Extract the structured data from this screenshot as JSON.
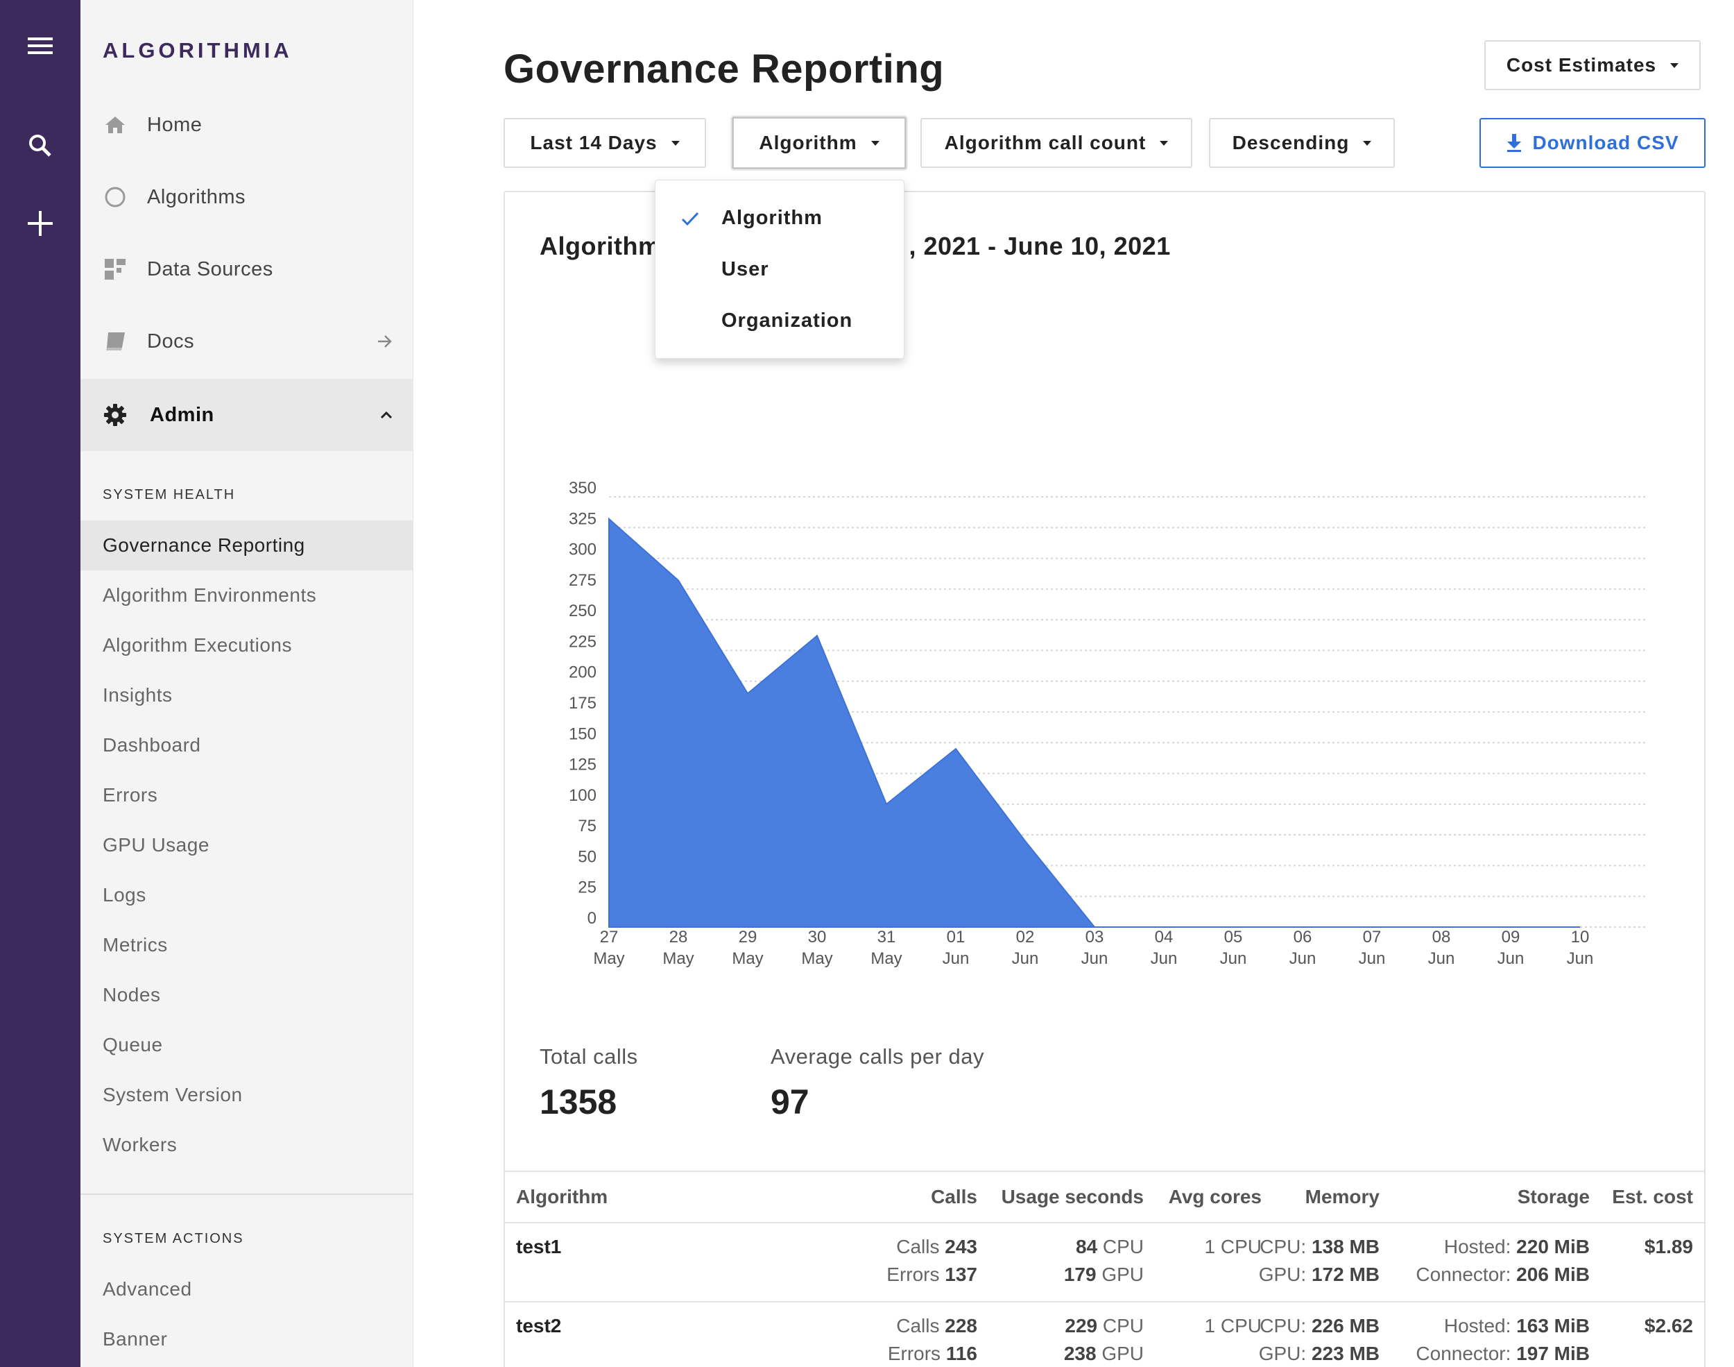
{
  "brand": {
    "logo_text": "ALGORITHMIA",
    "logo_color": "#3c2a5c",
    "rail_color": "#3c2a5c"
  },
  "rail": {
    "icons": [
      "menu-icon",
      "search-icon",
      "plus-icon"
    ]
  },
  "sidebar": {
    "nav": [
      {
        "label": "Home",
        "icon": "home-icon"
      },
      {
        "label": "Algorithms",
        "icon": "circle-icon"
      },
      {
        "label": "Data Sources",
        "icon": "data-sources-icon"
      },
      {
        "label": "Docs",
        "icon": "book-icon",
        "right_icon": "arrow-right-icon"
      },
      {
        "label": "Admin",
        "icon": "gear-icon",
        "right_icon": "chevron-up-icon",
        "active": true
      }
    ],
    "system_health_label": "SYSTEM HEALTH",
    "system_health_items": [
      {
        "label": "Governance Reporting",
        "active": true
      },
      {
        "label": "Algorithm Environments"
      },
      {
        "label": "Algorithm Executions"
      },
      {
        "label": "Insights"
      },
      {
        "label": "Dashboard"
      },
      {
        "label": "Errors"
      },
      {
        "label": "GPU Usage"
      },
      {
        "label": "Logs"
      },
      {
        "label": "Metrics"
      },
      {
        "label": "Nodes"
      },
      {
        "label": "Queue"
      },
      {
        "label": "System Version"
      },
      {
        "label": "Workers"
      }
    ],
    "system_actions_label": "SYSTEM ACTIONS",
    "system_actions_items": [
      {
        "label": "Advanced"
      },
      {
        "label": "Banner"
      }
    ]
  },
  "header": {
    "title": "Governance Reporting",
    "cost_estimates_label": "Cost Estimates",
    "filters": {
      "range_label": "Last 14 Days",
      "group_label": "Algorithm",
      "metric_label": "Algorithm call count",
      "order_label": "Descending"
    },
    "download_label": "Download CSV",
    "accent_color": "#2f6fd8"
  },
  "dropdown": {
    "items": [
      {
        "label": "Algorithm",
        "checked": true
      },
      {
        "label": "User",
        "checked": false
      },
      {
        "label": "Organization",
        "checked": false
      }
    ]
  },
  "chart_data": {
    "type": "area",
    "title_left": "Algorithm",
    "title_right": ", 2021 - June 10, 2021",
    "color": "#4a7fe0",
    "x": [
      "27 May",
      "28 May",
      "29 May",
      "30 May",
      "31 May",
      "01 Jun",
      "02 Jun",
      "03 Jun",
      "04 Jun",
      "05 Jun",
      "06 Jun",
      "07 Jun",
      "08 Jun",
      "09 Jun",
      "10 Jun"
    ],
    "x_ticks": [
      {
        "day": "27",
        "month": "May"
      },
      {
        "day": "28",
        "month": "May"
      },
      {
        "day": "29",
        "month": "May"
      },
      {
        "day": "30",
        "month": "May"
      },
      {
        "day": "31",
        "month": "May"
      },
      {
        "day": "01",
        "month": "Jun"
      },
      {
        "day": "02",
        "month": "Jun"
      },
      {
        "day": "03",
        "month": "Jun"
      },
      {
        "day": "04",
        "month": "Jun"
      },
      {
        "day": "05",
        "month": "Jun"
      },
      {
        "day": "06",
        "month": "Jun"
      },
      {
        "day": "07",
        "month": "Jun"
      },
      {
        "day": "08",
        "month": "Jun"
      },
      {
        "day": "09",
        "month": "Jun"
      },
      {
        "day": "10",
        "month": "Jun"
      }
    ],
    "values": [
      332,
      282,
      190,
      237,
      100,
      145,
      70,
      0,
      0,
      0,
      0,
      0,
      0,
      0,
      0
    ],
    "ylim": [
      0,
      350
    ],
    "y_ticks": [
      0,
      25,
      50,
      75,
      100,
      125,
      150,
      175,
      200,
      225,
      250,
      275,
      300,
      325,
      350
    ],
    "grid": true
  },
  "stats": {
    "total_calls_label": "Total calls",
    "total_calls_value": "1358",
    "avg_calls_label": "Average calls per day",
    "avg_calls_value": "97"
  },
  "table": {
    "headers": [
      "Algorithm",
      "Calls",
      "Usage seconds",
      "Avg cores",
      "Memory",
      "Storage",
      "Est. cost"
    ],
    "rows": [
      {
        "name": "test1",
        "calls_label": "Calls",
        "calls": "243",
        "errors_label": "Errors",
        "errors": "137",
        "cpu_seconds": "84",
        "cpu_unit": "CPU",
        "gpu_seconds": "179",
        "gpu_unit": "GPU",
        "avg_cores": "1 CPU",
        "mem_cpu_label": "CPU:",
        "mem_cpu": "138 MB",
        "mem_gpu_label": "GPU:",
        "mem_gpu": "172 MB",
        "hosted_label": "Hosted:",
        "hosted": "220 MiB",
        "connector_label": "Connector:",
        "connector": "206 MiB",
        "cost": "$1.89"
      },
      {
        "name": "test2",
        "calls_label": "Calls",
        "calls": "228",
        "errors_label": "Errors",
        "errors": "116",
        "cpu_seconds": "229",
        "cpu_unit": "CPU",
        "gpu_seconds": "238",
        "gpu_unit": "GPU",
        "avg_cores": "1 CPU",
        "mem_cpu_label": "CPU:",
        "mem_cpu": "226 MB",
        "mem_gpu_label": "GPU:",
        "mem_gpu": "223 MB",
        "hosted_label": "Hosted:",
        "hosted": "163 MiB",
        "connector_label": "Connector:",
        "connector": "197 MiB",
        "cost": "$2.62"
      }
    ]
  }
}
